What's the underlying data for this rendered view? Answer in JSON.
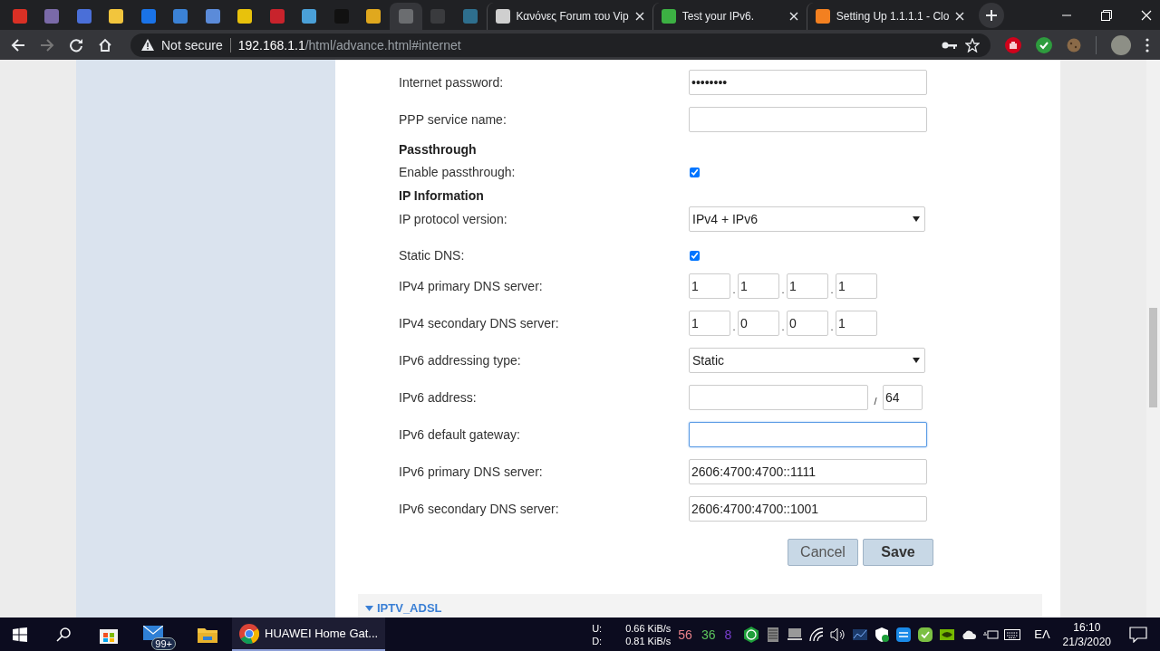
{
  "browser": {
    "tabs": [
      {
        "selected": false,
        "color": "#d93025"
      },
      {
        "selected": false,
        "color": "#7a6aa8"
      },
      {
        "selected": false,
        "color": "#4a6fd8"
      },
      {
        "selected": false,
        "color": "#f2c53d"
      },
      {
        "selected": false,
        "color": "#1a73e8"
      },
      {
        "selected": false,
        "color": "#3b82d6"
      },
      {
        "selected": false,
        "color": "#5b8bd9"
      },
      {
        "selected": false,
        "color": "#e8c20c"
      },
      {
        "selected": false,
        "color": "#c8232c"
      },
      {
        "selected": false,
        "color": "#4aa0d8"
      },
      {
        "selected": false,
        "color": "#111111"
      },
      {
        "selected": false,
        "color": "#e0a81e"
      },
      {
        "selected": true,
        "color": "#6b6d70"
      },
      {
        "selected": false,
        "color": "#3a3b3e"
      },
      {
        "selected": false,
        "color": "#2e6f8e"
      },
      {
        "selected": false,
        "color": "#cfcfcf",
        "title": "Κανόνες Forum του Vip"
      },
      {
        "selected": false,
        "color": "#3cb043",
        "title": "Test your IPv6."
      },
      {
        "selected": false,
        "color": "#f38020",
        "title": "Setting Up 1.1.1.1 - Clo"
      }
    ],
    "address_bar": {
      "security_label": "Not secure",
      "url_host": "192.168.1.1",
      "url_path": "/html/advance.html#internet"
    }
  },
  "form": {
    "rows": [
      {
        "kind": "password",
        "label": "Internet password:",
        "value": "••••••••",
        "focused": false
      },
      {
        "kind": "text",
        "label": "PPP service name:",
        "focused": false
      },
      {
        "kind": "heading",
        "label": "Passthrough"
      },
      {
        "kind": "checkbox",
        "label": "Enable passthrough:",
        "checked": true
      },
      {
        "kind": "heading",
        "label": "IP Information"
      },
      {
        "kind": "select",
        "label": "IP protocol version:",
        "value": "IPv4 + IPv6"
      },
      {
        "kind": "checkbox",
        "label": "Static DNS:",
        "checked": true
      },
      {
        "kind": "ipv4",
        "label": "IPv4 primary DNS server:",
        "octets": [
          "1",
          "1",
          "1",
          "1"
        ],
        "separator": "."
      },
      {
        "kind": "ipv4",
        "label": "IPv4 secondary DNS server:",
        "octets": [
          "1",
          "0",
          "0",
          "1"
        ],
        "separator": "."
      },
      {
        "kind": "select",
        "label": "IPv6 addressing type:",
        "value": "Static"
      },
      {
        "kind": "ipv6",
        "label": "IPv6 address:",
        "separator": "/",
        "prefix": "64"
      },
      {
        "kind": "text",
        "label": "IPv6 default gateway:",
        "focused": true
      },
      {
        "kind": "text",
        "label": "IPv6 primary DNS server:",
        "value": "2606:4700:4700::1111",
        "focused": false
      },
      {
        "kind": "text",
        "label": "IPv6 secondary DNS server:",
        "value": "2606:4700:4700::1001",
        "focused": false
      }
    ],
    "buttons": [
      {
        "label": "Cancel",
        "kind": "secondary"
      },
      {
        "label": "Save",
        "kind": "primary"
      }
    ]
  },
  "next_section": {
    "title": "IPTV_ADSL"
  },
  "taskbar": {
    "app": {
      "label": "HUAWEI Home Gat...",
      "active": true
    },
    "mail_badge": "99+",
    "net_labels": [
      "U:",
      "D:"
    ],
    "net_speeds": [
      "0.66 KiB/s",
      "0.81 KiB/s"
    ],
    "counters": [
      {
        "text": "56",
        "color": "#e8828a"
      },
      {
        "text": "36",
        "color": "#5cc45c"
      },
      {
        "text": "8",
        "color": "#7a3fd0"
      }
    ],
    "language": "ΕΛ",
    "time": "16:10",
    "date": "21/3/2020"
  }
}
